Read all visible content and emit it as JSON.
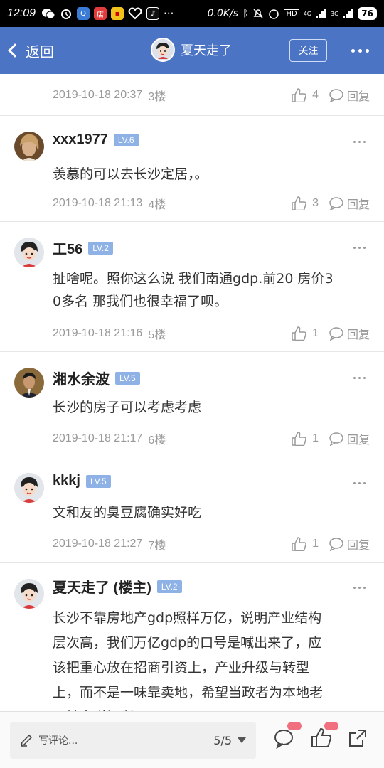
{
  "status_bar": {
    "time": "12:09",
    "net_speed": "0.0K/s",
    "hd": "HD",
    "net_4g": "4G",
    "net_3g": "3G",
    "battery": "76",
    "app_label": "店"
  },
  "header": {
    "back_label": "返回",
    "title": "夏天走了",
    "follow_label": "关注"
  },
  "top_meta": {
    "time": "2019-10-18 20:37",
    "floor": "3楼",
    "likes": "4",
    "reply": "回复"
  },
  "posts": [
    {
      "username": "xxx1977",
      "level": "LV.6",
      "content": [
        "羡慕的可以去长沙定居，。"
      ],
      "time": "2019-10-18 21:13",
      "floor": "4楼",
      "likes": "3",
      "reply": "回复"
    },
    {
      "username": "工56",
      "level": "LV.2",
      "content": [
        "扯啥呢。照你这么说 我们南通gdp.前20 房价3",
        "0多名 那我们也很幸福了呗。"
      ],
      "time": "2019-10-18 21:16",
      "floor": "5楼",
      "likes": "1",
      "reply": "回复"
    },
    {
      "username": "湘水余波",
      "level": "LV.5",
      "content": [
        "长沙的房子可以考虑考虑"
      ],
      "time": "2019-10-18 21:17",
      "floor": "6楼",
      "likes": "1",
      "reply": "回复"
    },
    {
      "username": "kkkj",
      "level": "LV.5",
      "content": [
        "文和友的臭豆腐确实好吃"
      ],
      "time": "2019-10-18 21:27",
      "floor": "7楼",
      "likes": "1",
      "reply": "回复"
    },
    {
      "username": "夏天走了 (楼主)",
      "level": "LV.2",
      "content": [
        "长沙不靠房地产gdp照样万亿，说明产业结构",
        "层次高，我们万亿gdp的口号是喊出来了，应",
        "该把重心放在招商引资上，产业升级与转型",
        "上，而不是一味靠卖地，希望当政者为本地老",
        "百姓多谋福利！"
      ]
    }
  ],
  "bottom_bar": {
    "comment_placeholder": "写评论...",
    "page_indicator": "5/5"
  }
}
